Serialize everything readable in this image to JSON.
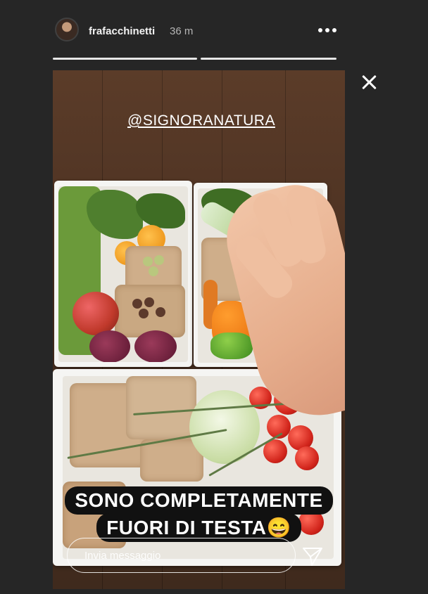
{
  "header": {
    "username": "frafacchinetti",
    "time_ago": "36 m",
    "more_icon": "more-horizontal-icon",
    "close_icon": "close-icon"
  },
  "story": {
    "mention": "@SIGNORANATURA",
    "caption_line1": "SONO COMPLETAMENTE",
    "caption_line2": "FUORI DI TESTA😄"
  },
  "reply": {
    "placeholder": "Invia messaggio",
    "send_icon": "send-icon"
  },
  "colors": {
    "background": "#262626",
    "progress": "#e6e6e6",
    "caption_bg": "#111111"
  }
}
